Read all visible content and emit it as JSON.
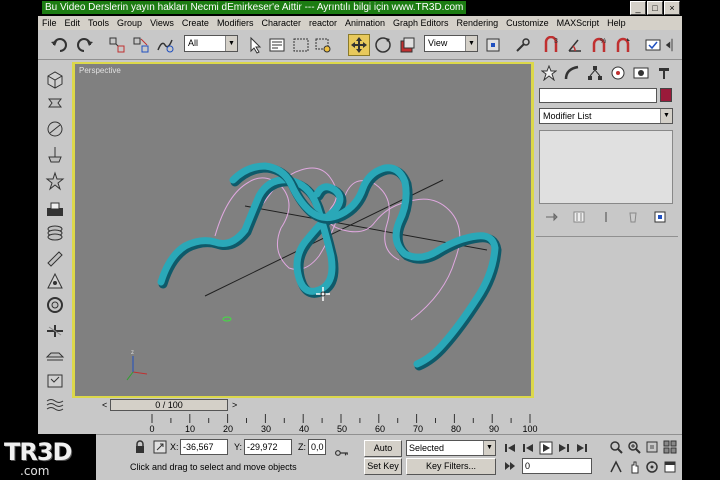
{
  "window": {
    "title": "Bu Video Derslerin yayın hakları Necmi dEmirkeser'e Aittir --- Ayrıntılı bilgi için www.TR3D.com",
    "controls": [
      "_",
      "□",
      "×"
    ]
  },
  "menu": [
    "File",
    "Edit",
    "Tools",
    "Group",
    "Views",
    "Create",
    "Modifiers",
    "Character",
    "reactor",
    "Animation",
    "Graph Editors",
    "Rendering",
    "Customize",
    "MAXScript",
    "Help"
  ],
  "toolbar": {
    "selection_filter": "All",
    "ref_coord": "View"
  },
  "viewport": {
    "label": "Perspective",
    "curve_color": "#2aa8b8",
    "spline_color": "#e0a8e0"
  },
  "command_panel": {
    "modifier_list": "Modifier List",
    "object_color": "#9a1a3a"
  },
  "time_slider": {
    "position": "0 / 100",
    "prev": "<",
    "next": ">"
  },
  "trackbar": {
    "ticks": [
      "0",
      "10",
      "20",
      "30",
      "40",
      "50",
      "60",
      "70",
      "80",
      "90",
      "100"
    ]
  },
  "status": {
    "x_label": "X:",
    "x_value": "-36,567",
    "y_label": "Y:",
    "y_value": "-29,972",
    "z_label": "Z:",
    "z_value": "0,0",
    "auto_key": "Auto Key",
    "set_key": "Set Key",
    "key_mode": "Selected",
    "key_filters": "Key Filters...",
    "frame": "0",
    "prompt": "Click and drag to select and move objects"
  },
  "logo": {
    "main": "TR3D",
    "sub": ".com"
  }
}
